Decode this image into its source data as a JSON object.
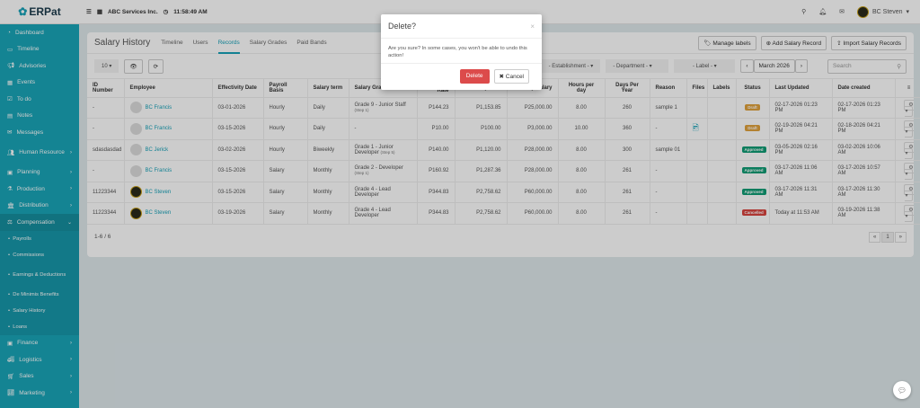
{
  "app": {
    "logo": "ERPat",
    "company": "ABC Services Inc.",
    "time": "11:58:49 AM",
    "user": "BC Steven"
  },
  "sidebar": {
    "items": [
      {
        "label": "Dashboard",
        "icon": "dashboard-icon"
      },
      {
        "label": "Timeline",
        "icon": "timeline-icon"
      },
      {
        "label": "Advisories",
        "icon": "megaphone-icon"
      },
      {
        "label": "Events",
        "icon": "calendar-icon"
      },
      {
        "label": "To do",
        "icon": "check-icon"
      },
      {
        "label": "Notes",
        "icon": "notes-icon"
      },
      {
        "label": "Messages",
        "icon": "envelope-icon"
      },
      {
        "label": "Human Resource",
        "icon": "users-icon",
        "chev": true
      },
      {
        "label": "Planning",
        "icon": "briefcase-icon",
        "chev": true
      },
      {
        "label": "Production",
        "icon": "flask-icon",
        "chev": true
      },
      {
        "label": "Distribution",
        "icon": "bank-icon",
        "chev": true
      }
    ],
    "open": {
      "label": "Compensation",
      "subitems": [
        "Payrolls",
        "Commissions",
        "Earnings & Deductions",
        "De Minimis Benefits",
        "Salary History",
        "Loans"
      ]
    },
    "after": [
      {
        "label": "Finance"
      },
      {
        "label": "Logistics"
      },
      {
        "label": "Sales"
      },
      {
        "label": "Marketing"
      }
    ]
  },
  "page": {
    "title": "Salary History",
    "tabs": [
      "Timeline",
      "Users",
      "Records",
      "Salary Grades",
      "Paid Bands"
    ],
    "active_tab": "Records",
    "buttons": {
      "manage": "Manage labels",
      "add": "Add Salary Record",
      "import": "Import Salary Records"
    },
    "toolbar": {
      "page_size": "10",
      "establishment": "- Establishment -",
      "department": "- Department -",
      "label": "- Label -",
      "month": "March 2026",
      "search_placeholder": "Search"
    }
  },
  "table": {
    "headers": [
      "ID Number",
      "Employee",
      "Effectivity Date",
      "Payroll Basis",
      "Salary term",
      "Salary Grade",
      "Hourly Rate",
      "Daily Rate",
      "Monthly Salary",
      "Hours per day",
      "Days Per Year",
      "Reason",
      "Files",
      "Labels",
      "Status",
      "Last Updated",
      "Date created"
    ],
    "rows": [
      {
        "id": "-",
        "emp": "BC Francis",
        "photo": false,
        "eff": "03-01-2026",
        "basis": "Hourly",
        "term": "Daily",
        "grade": "Grade 9 - Junior Staff",
        "step": "(Step 1)",
        "hourly": "P144.23",
        "daily": "P1,153.85",
        "monthly": "P25,000.00",
        "hours": "8.00",
        "days": "260",
        "reason": "sample 1",
        "file": false,
        "status": "Draft",
        "status_color": "#e0a23c",
        "updated": "02-17-2026 01:23 PM",
        "created": "02-17-2026 01:23 PM"
      },
      {
        "id": "-",
        "emp": "BC Francis",
        "photo": false,
        "eff": "03-15-2026",
        "basis": "Hourly",
        "term": "Daily",
        "grade": "-",
        "step": "",
        "hourly": "P10.00",
        "daily": "P100.00",
        "monthly": "P3,000.00",
        "hours": "10.00",
        "days": "360",
        "reason": "-",
        "file": true,
        "status": "Draft",
        "status_color": "#e0a23c",
        "updated": "02-19-2026 04:21 PM",
        "created": "02-18-2026 04:21 PM"
      },
      {
        "id": "sdasdasdad",
        "emp": "BC Jerick",
        "photo": false,
        "eff": "03-02-2026",
        "basis": "Hourly",
        "term": "Biweekly",
        "grade": "Grade 1 - Junior Developer",
        "step": "(Step 5)",
        "hourly": "P140.00",
        "daily": "P1,120.00",
        "monthly": "P28,000.00",
        "hours": "8.00",
        "days": "300",
        "reason": "sample 01",
        "file": false,
        "status": "Approved",
        "status_color": "#0f9d75",
        "updated": "03-05-2026 02:16 PM",
        "created": "03-02-2026 10:06 AM"
      },
      {
        "id": "-",
        "emp": "BC Francis",
        "photo": false,
        "eff": "03-15-2026",
        "basis": "Salary",
        "term": "Monthly",
        "grade": "Grade 2 - Developer",
        "step": "(Step 1)",
        "hourly": "P160.92",
        "daily": "P1,287.36",
        "monthly": "P28,000.00",
        "hours": "8.00",
        "days": "261",
        "reason": "-",
        "file": false,
        "status": "Approved",
        "status_color": "#0f9d75",
        "updated": "03-17-2026 11:06 AM",
        "created": "03-17-2026 10:57 AM"
      },
      {
        "id": "11223344",
        "emp": "BC Steven",
        "photo": true,
        "eff": "03-15-2026",
        "basis": "Salary",
        "term": "Monthly",
        "grade": "Grade 4 - Lead Developer",
        "step": "",
        "hourly": "P344.83",
        "daily": "P2,758.62",
        "monthly": "P60,000.00",
        "hours": "8.00",
        "days": "261",
        "reason": "-",
        "file": false,
        "status": "Approved",
        "status_color": "#0f9d75",
        "updated": "03-17-2026 11:31 AM",
        "created": "03-17-2026 11:30 AM"
      },
      {
        "id": "11223344",
        "emp": "BC Steven",
        "photo": true,
        "eff": "03-19-2026",
        "basis": "Salary",
        "term": "Monthly",
        "grade": "Grade 4 - Lead Developer",
        "step": "",
        "hourly": "P344.83",
        "daily": "P2,758.62",
        "monthly": "P60,000.00",
        "hours": "8.00",
        "days": "261",
        "reason": "-",
        "file": false,
        "status": "Cancelled",
        "status_color": "#d9443f",
        "updated": "Today at 11:53 AM",
        "created": "03-19-2026 11:38 AM"
      }
    ],
    "footer": "1-6 / 6",
    "page": "1"
  },
  "modal": {
    "title": "Delete?",
    "message": "Are you sure? In some cases, you won't be able to undo this action!",
    "delete": "Delete",
    "cancel": "Cancel"
  }
}
